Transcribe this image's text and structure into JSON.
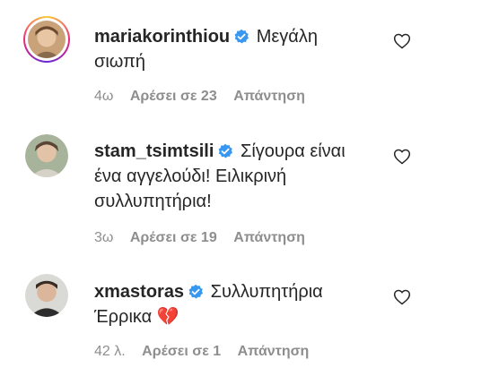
{
  "comments": [
    {
      "username": "mariakorinthiou",
      "text": "Μεγάλη σιωπή",
      "time": "4ω",
      "likes": "Αρέσει σε 23",
      "reply": "Απάντηση",
      "avatar_icon": "profile-photo"
    },
    {
      "username": "stam_tsimtsili",
      "text": "Σίγουρα είναι ένα αγγελούδι! Ειλικρινή συλλυπητήρια!",
      "time": "3ω",
      "likes": "Αρέσει σε 19",
      "reply": "Απάντηση",
      "avatar_icon": "profile-photo"
    },
    {
      "username": "xmastoras",
      "text": "Συλλυπητήρια Έρρικα",
      "emoji": "💔",
      "time": "42 λ.",
      "likes": "Αρέσει σε 1",
      "reply": "Απάντηση",
      "avatar_icon": "profile-photo"
    }
  ],
  "colors": {
    "verified": "#3897f0",
    "meta_text": "#8e8e8e",
    "text": "#262626"
  }
}
